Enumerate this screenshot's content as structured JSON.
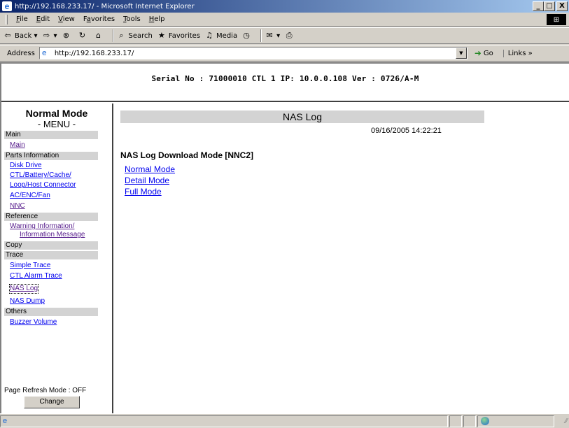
{
  "window": {
    "title": "http://192.168.233.17/ - Microsoft Internet Explorer",
    "buttons": {
      "minimize": "_",
      "maximize": "□",
      "close": "X"
    }
  },
  "menubar": {
    "items": [
      {
        "key": "F",
        "rest": "ile"
      },
      {
        "key": "E",
        "rest": "dit"
      },
      {
        "key": "V",
        "rest": "iew"
      },
      {
        "pre": "F",
        "key": "a",
        "rest": "vorites"
      },
      {
        "key": "T",
        "rest": "ools"
      },
      {
        "key": "H",
        "rest": "elp"
      }
    ]
  },
  "toolbar": {
    "back_label": "Back",
    "search_label": "Search",
    "favorites_label": "Favorites",
    "media_label": "Media"
  },
  "addressbar": {
    "label": "Address",
    "url": "http://192.168.233.17/",
    "go_label": "Go",
    "links_label": "Links »"
  },
  "header": {
    "serial_text": "Serial No : 71000010  CTL 1  IP: 10.0.0.108  Ver : 0726/A-M"
  },
  "sidebar": {
    "mode_title": "Normal Mode",
    "menu_label": "- MENU -",
    "sections": {
      "main": "Main",
      "parts": "Parts Information",
      "reference": "Reference",
      "copy": "Copy",
      "trace": "Trace",
      "others": "Others"
    },
    "links": {
      "main": "Main",
      "disk_drive": "Disk Drive",
      "ctl_battery": "CTL/Battery/Cache/",
      "loop_host": "Loop/Host Connector",
      "ac_enc_fan": "AC/ENC/Fan",
      "nnc": "NNC",
      "warning_info": "Warning Information/",
      "info_message": "Information Message",
      "simple_trace": "Simple Trace",
      "ctl_alarm_trace": "CTL Alarm Trace",
      "nas_log": "NAS Log",
      "nas_dump": "NAS Dump",
      "buzzer_volume": "Buzzer Volume"
    },
    "refresh_mode": "Page Refresh Mode : OFF",
    "change_button": "Change"
  },
  "main": {
    "title": "NAS Log",
    "date": "09/16/2005 14:22:21",
    "heading": "NAS Log Download Mode [NNC2]",
    "links": [
      "Normal Mode",
      "Detail Mode",
      "Full Mode"
    ]
  },
  "colors": {
    "link": "#0000ee",
    "visited": "#551a8b",
    "section_bg": "#d3d3d3",
    "chrome": "#d4d0c8"
  }
}
